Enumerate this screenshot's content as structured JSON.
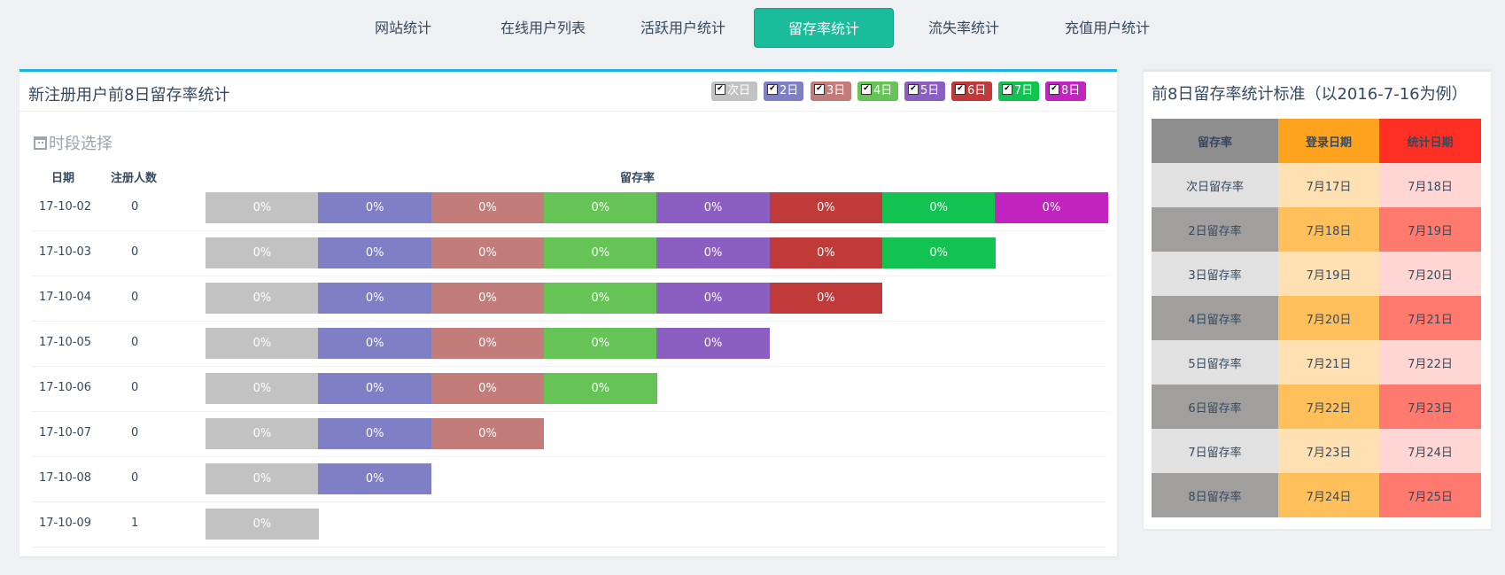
{
  "nav": {
    "tabs": [
      {
        "label": "网站统计",
        "active": false
      },
      {
        "label": "在线用户列表",
        "active": false
      },
      {
        "label": "活跃用户统计",
        "active": false
      },
      {
        "label": "留存率统计",
        "active": true
      },
      {
        "label": "流失率统计",
        "active": false
      },
      {
        "label": "充值用户统计",
        "active": false
      }
    ]
  },
  "left_panel": {
    "title": "新注册用户前8日留存率统计",
    "legend": [
      {
        "label": "次日",
        "color": "#c2c2c2",
        "checked": true
      },
      {
        "label": "2日",
        "color": "#7e7fc4",
        "checked": true
      },
      {
        "label": "3日",
        "color": "#c27d7b",
        "checked": true
      },
      {
        "label": "4日",
        "color": "#66c355",
        "checked": true
      },
      {
        "label": "5日",
        "color": "#8b5fc2",
        "checked": true
      },
      {
        "label": "6日",
        "color": "#c03a3a",
        "checked": true
      },
      {
        "label": "7日",
        "color": "#12c351",
        "checked": true
      },
      {
        "label": "8日",
        "color": "#c124bf",
        "checked": true
      }
    ],
    "period_label": "时段选择",
    "headers": {
      "date": "日期",
      "count": "注册人数",
      "rate": "留存率"
    },
    "rows": [
      {
        "date": "17-10-02",
        "count": "0",
        "rates": [
          "0%",
          "0%",
          "0%",
          "0%",
          "0%",
          "0%",
          "0%",
          "0%"
        ]
      },
      {
        "date": "17-10-03",
        "count": "0",
        "rates": [
          "0%",
          "0%",
          "0%",
          "0%",
          "0%",
          "0%",
          "0%"
        ]
      },
      {
        "date": "17-10-04",
        "count": "0",
        "rates": [
          "0%",
          "0%",
          "0%",
          "0%",
          "0%",
          "0%"
        ]
      },
      {
        "date": "17-10-05",
        "count": "0",
        "rates": [
          "0%",
          "0%",
          "0%",
          "0%",
          "0%"
        ]
      },
      {
        "date": "17-10-06",
        "count": "0",
        "rates": [
          "0%",
          "0%",
          "0%",
          "0%"
        ]
      },
      {
        "date": "17-10-07",
        "count": "0",
        "rates": [
          "0%",
          "0%",
          "0%"
        ]
      },
      {
        "date": "17-10-08",
        "count": "0",
        "rates": [
          "0%",
          "0%"
        ]
      },
      {
        "date": "17-10-09",
        "count": "1",
        "rates": [
          "0%"
        ]
      }
    ]
  },
  "right_panel": {
    "title": "前8日留存率统计标准（以2016-7-16为例）",
    "headers": [
      "留存率",
      "登录日期",
      "统计日期"
    ],
    "header_colors": [
      "#8e8e8e",
      "#ffa31f",
      "#ff2f23"
    ],
    "rows": [
      {
        "label": "次日留存率",
        "login": "7月17日",
        "stat": "7月18日"
      },
      {
        "label": "2日留存率",
        "login": "7月18日",
        "stat": "7月19日"
      },
      {
        "label": "3日留存率",
        "login": "7月19日",
        "stat": "7月20日"
      },
      {
        "label": "4日留存率",
        "login": "7月20日",
        "stat": "7月21日"
      },
      {
        "label": "5日留存率",
        "login": "7月21日",
        "stat": "7月22日"
      },
      {
        "label": "6日留存率",
        "login": "7月22日",
        "stat": "7月23日"
      },
      {
        "label": "7日留存率",
        "login": "7月23日",
        "stat": "7月24日"
      },
      {
        "label": "8日留存率",
        "login": "7月24日",
        "stat": "7月25日"
      }
    ],
    "light_colors": [
      "#e1e1e1",
      "#ffe0b3",
      "#ffd6d3"
    ],
    "dark_colors": [
      "#a19e9e",
      "#ffc05c",
      "#ff7a6e"
    ]
  }
}
